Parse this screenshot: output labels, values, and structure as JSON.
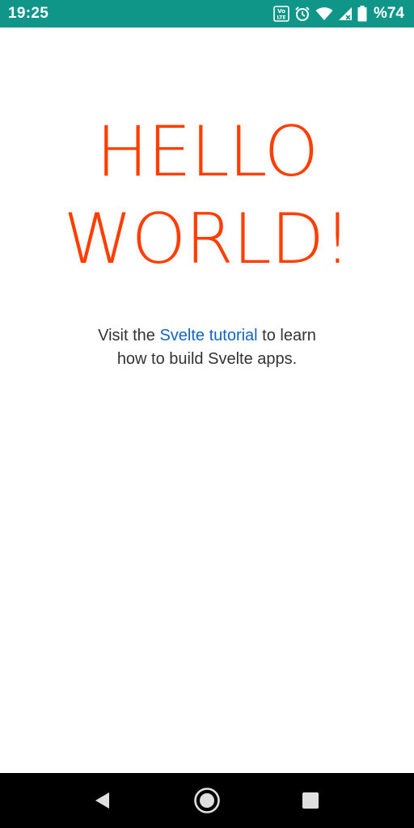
{
  "status_bar": {
    "time": "19:25",
    "battery_text": "%74",
    "background_color": "#109688",
    "icons": [
      "volte-icon",
      "alarm-icon",
      "wifi-icon",
      "signal-icon",
      "battery-icon"
    ]
  },
  "main": {
    "title_line1": "Hello",
    "title_line2": "world!",
    "title_color": "#ff3e00",
    "intro_before": "Visit the ",
    "intro_link": "Svelte tutorial",
    "intro_after_line1": " to learn",
    "intro_line2": "how to build Svelte apps.",
    "link_color": "#1565c0"
  },
  "nav_bar": {
    "buttons": [
      "back-icon",
      "home-icon",
      "recents-icon"
    ]
  }
}
